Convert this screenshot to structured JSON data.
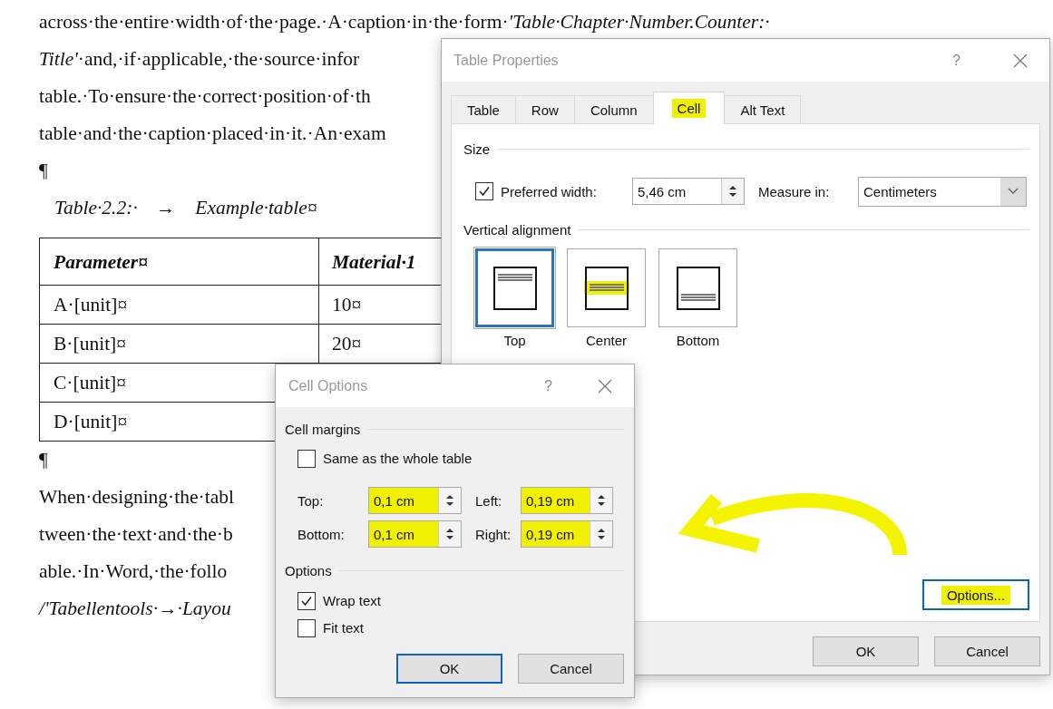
{
  "document": {
    "blocks": [
      {
        "kind": "line",
        "italic": false,
        "text": "across·the·entire·width·of·the·page.·A·caption·in·the·form·*'Table·Chapter·Number.Counter:·*"
      },
      {
        "kind": "line",
        "italic": false,
        "text": "*Title'*·and,·if·applicable,·the·source·infor"
      },
      {
        "kind": "line",
        "italic": false,
        "text": "table.·To·ensure·the·correct·position·of·th"
      },
      {
        "kind": "line",
        "italic": false,
        "text": "table·and·the·caption·placed·in·it.·An·exam"
      },
      {
        "kind": "mark",
        "text": "¶"
      },
      {
        "kind": "caption",
        "label": "Table·2.2:·",
        "arrow": "→",
        "title": "Example·table¤"
      },
      {
        "kind": "table",
        "columns": [
          "Parameter¤",
          "Material·1"
        ],
        "rows": [
          [
            "A·[unit]¤",
            "10¤"
          ],
          [
            "B·[unit]¤",
            "20¤"
          ],
          [
            "C·[unit]¤"
          ],
          [
            "D·[unit]¤"
          ]
        ]
      },
      {
        "kind": "mark",
        "text": "¶"
      },
      {
        "kind": "line",
        "italic": false,
        "text": "When·designing·the·tabl"
      },
      {
        "kind": "line",
        "italic": false,
        "text": "tween·the·text·and·the·b"
      },
      {
        "kind": "line",
        "italic": false,
        "text": "able.·In·Word,·the·follo"
      },
      {
        "kind": "line",
        "italic": true,
        "text": "/'Tabellentools·→·Layou"
      }
    ]
  },
  "table_properties": {
    "title": "Table Properties",
    "help": "?",
    "tabs": [
      {
        "label": "Table",
        "selected": false,
        "highlighted": false
      },
      {
        "label": "Row",
        "selected": false,
        "highlighted": false
      },
      {
        "label": "Column",
        "selected": false,
        "highlighted": false
      },
      {
        "label": "Cell",
        "selected": true,
        "highlighted": true
      },
      {
        "label": "Alt Text",
        "selected": false,
        "highlighted": false
      }
    ],
    "size": {
      "heading": "Size",
      "preferred_width": {
        "label": "Preferred width:",
        "checked": true,
        "value": "5,46 cm"
      },
      "measure_in": {
        "label": "Measure in:",
        "value": "Centimeters"
      }
    },
    "vertical_alignment": {
      "heading": "Vertical alignment",
      "options": [
        {
          "kind": "top",
          "label": "Top",
          "selected": true,
          "highlighted": false
        },
        {
          "kind": "center",
          "label": "Center",
          "selected": false,
          "highlighted": true
        },
        {
          "kind": "bottom",
          "label": "Bottom",
          "selected": false,
          "highlighted": false
        }
      ]
    },
    "options_button": {
      "label": "Options...",
      "focused": true,
      "highlighted": true
    },
    "buttons": [
      {
        "label": "OK",
        "focused": false
      },
      {
        "label": "Cancel",
        "focused": false
      }
    ]
  },
  "cell_options": {
    "title": "Cell Options",
    "help": "?",
    "margins": {
      "heading": "Cell margins",
      "same_as_table": {
        "label": "Same as the whole table",
        "checked": false
      },
      "fields": [
        {
          "label": "Top:",
          "value": "0,1 cm",
          "highlighted": true
        },
        {
          "label": "Left:",
          "value": "0,19 cm",
          "highlighted": true
        },
        {
          "label": "Bottom:",
          "value": "0,1 cm",
          "highlighted": true
        },
        {
          "label": "Right:",
          "value": "0,19 cm",
          "highlighted": true
        }
      ]
    },
    "options": {
      "heading": "Options",
      "checkboxes": [
        {
          "label": "Wrap text",
          "checked": true
        },
        {
          "label": "Fit text",
          "checked": false
        }
      ]
    },
    "buttons": [
      {
        "label": "OK",
        "focused": true
      },
      {
        "label": "Cancel",
        "focused": false
      }
    ]
  }
}
